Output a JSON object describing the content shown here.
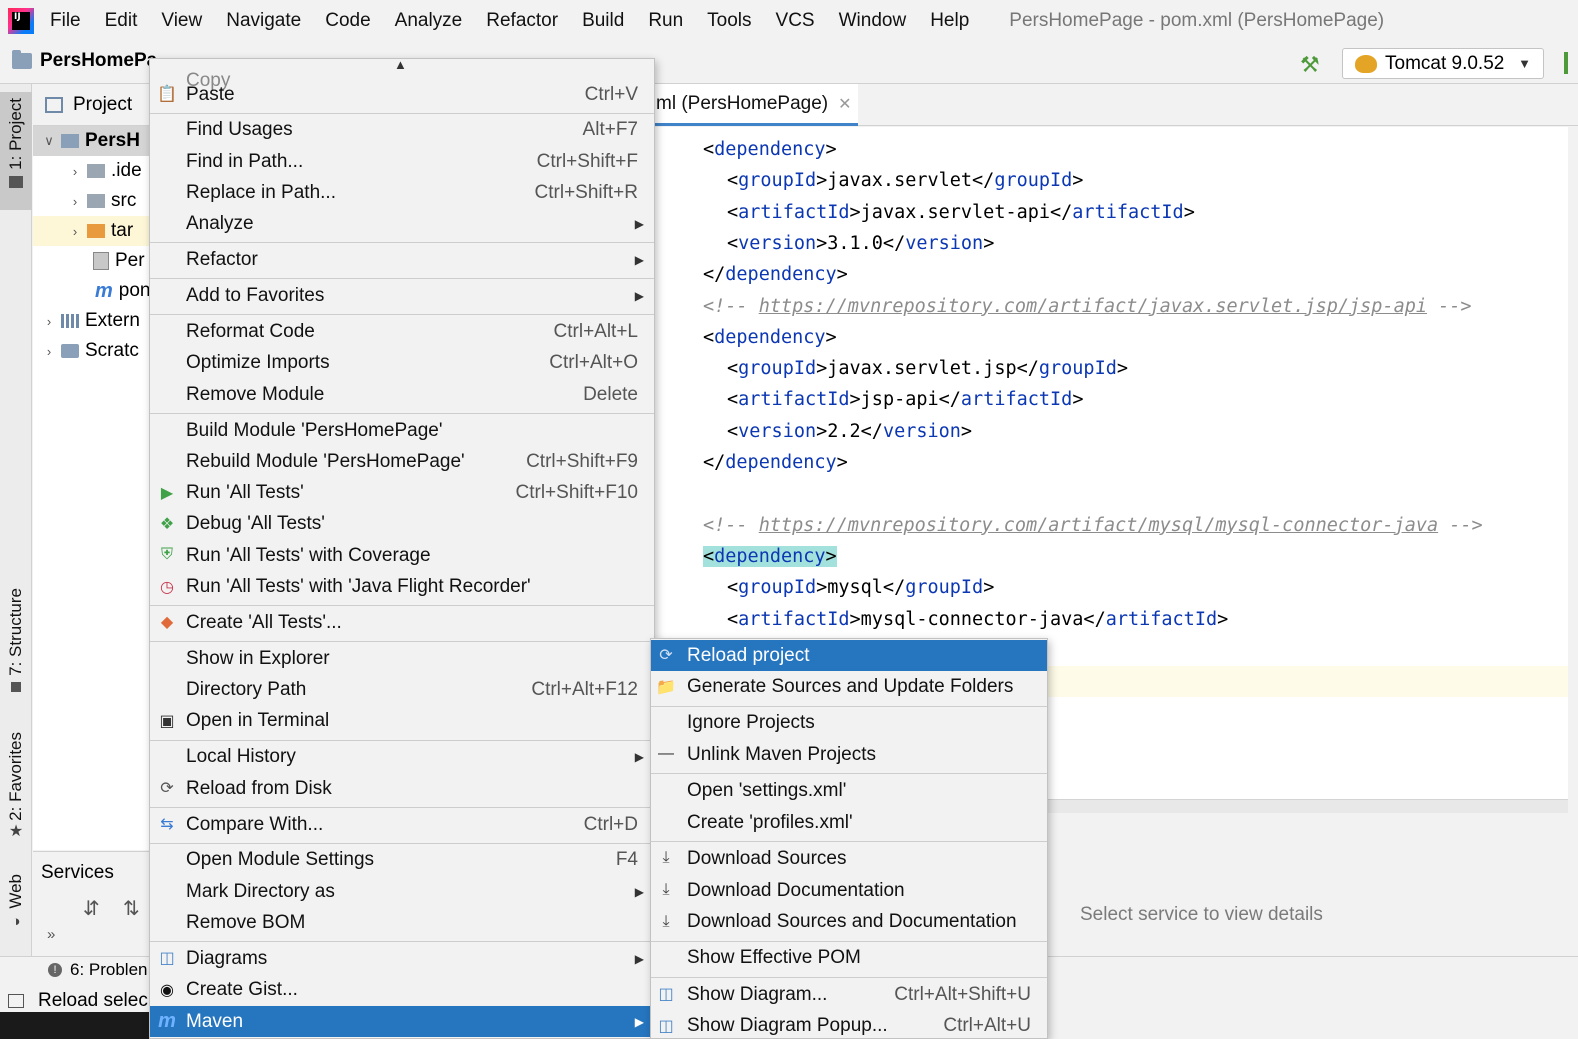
{
  "menubar": {
    "logo_text": "IJ",
    "items": [
      "File",
      "Edit",
      "View",
      "Navigate",
      "Code",
      "Analyze",
      "Refactor",
      "Build",
      "Run",
      "Tools",
      "VCS",
      "Window",
      "Help"
    ],
    "window_title": "PersHomePage - pom.xml (PersHomePage)"
  },
  "toolbar": {
    "project_name": "PersHomePa",
    "run_config": "Tomcat 9.0.52"
  },
  "left_tabs": {
    "project": "1: Project",
    "structure": "7: Structure",
    "favorites": "2: Favorites",
    "web": "Web"
  },
  "project_panel": {
    "title": "Project",
    "rows": [
      {
        "label": "PersH",
        "bold": true
      },
      {
        "label": ".ide"
      },
      {
        "label": "src"
      },
      {
        "label": "tar"
      },
      {
        "label": "Per"
      },
      {
        "label": "pon"
      },
      {
        "label": "Extern"
      },
      {
        "label": "Scratc"
      }
    ]
  },
  "services": {
    "title": "Services",
    "empty_message": "Select service to view details",
    "more": "»"
  },
  "status": {
    "problems": "6: Problen",
    "message": "Reload selec"
  },
  "editor": {
    "tab_title": "ml (PersHomePage)",
    "lines": [
      {
        "indent": 0,
        "tag": "dependency",
        "close": false
      },
      {
        "indent": 1,
        "tag": "groupId",
        "value": "javax.servlet"
      },
      {
        "indent": 1,
        "tag": "artifactId",
        "value": "javax.servlet-api"
      },
      {
        "indent": 1,
        "tag": "version",
        "value": "3.1.0"
      },
      {
        "indent": 0,
        "tag": "dependency",
        "close": true
      },
      {
        "comment": "https://mvnrepository.com/artifact/javax.servlet.jsp/jsp-api"
      },
      {
        "indent": 0,
        "tag": "dependency",
        "close": false
      },
      {
        "indent": 1,
        "tag": "groupId",
        "value": "javax.servlet.jsp"
      },
      {
        "indent": 1,
        "tag": "artifactId",
        "value": "jsp-api"
      },
      {
        "indent": 1,
        "tag": "version",
        "value": "2.2"
      },
      {
        "indent": 0,
        "tag": "dependency",
        "close": true
      },
      {
        "blank": true
      },
      {
        "comment": "https://mvnrepository.com/artifact/mysql/mysql-connector-java"
      },
      {
        "indent": 0,
        "tag": "dependency",
        "close": false,
        "highlight": true
      },
      {
        "indent": 1,
        "tag": "groupId",
        "value": "mysql"
      },
      {
        "indent": 1,
        "tag": "artifactId",
        "value": "mysql-connector-java"
      }
    ]
  },
  "context_menu": {
    "items": [
      {
        "label": "Copy",
        "partial": true
      },
      {
        "label": "Paste",
        "shortcut": "Ctrl+V",
        "icon": "clipboard-icon"
      },
      {
        "sep": true
      },
      {
        "label": "Find Usages",
        "shortcut": "Alt+F7"
      },
      {
        "label": "Find in Path...",
        "shortcut": "Ctrl+Shift+F"
      },
      {
        "label": "Replace in Path...",
        "shortcut": "Ctrl+Shift+R"
      },
      {
        "label": "Analyze",
        "submenu": true
      },
      {
        "sep": true
      },
      {
        "label": "Refactor",
        "submenu": true
      },
      {
        "sep": true
      },
      {
        "label": "Add to Favorites",
        "submenu": true
      },
      {
        "sep": true
      },
      {
        "label": "Reformat Code",
        "shortcut": "Ctrl+Alt+L"
      },
      {
        "label": "Optimize Imports",
        "shortcut": "Ctrl+Alt+O"
      },
      {
        "label": "Remove Module",
        "shortcut": "Delete"
      },
      {
        "sep": true
      },
      {
        "label": "Build Module 'PersHomePage'"
      },
      {
        "label": "Rebuild Module 'PersHomePage'",
        "shortcut": "Ctrl+Shift+F9"
      },
      {
        "label": "Run 'All Tests'",
        "shortcut": "Ctrl+Shift+F10",
        "icon": "run-icon"
      },
      {
        "label": "Debug 'All Tests'",
        "icon": "debug-icon"
      },
      {
        "label": "Run 'All Tests' with Coverage",
        "icon": "coverage-icon"
      },
      {
        "label": "Run 'All Tests' with 'Java Flight Recorder'",
        "icon": "profiler-icon"
      },
      {
        "sep": true
      },
      {
        "label": "Create 'All Tests'...",
        "icon": "create-test-icon"
      },
      {
        "sep": true
      },
      {
        "label": "Show in Explorer"
      },
      {
        "label": "Directory Path",
        "shortcut": "Ctrl+Alt+F12"
      },
      {
        "label": "Open in Terminal",
        "icon": "terminal-icon"
      },
      {
        "sep": true
      },
      {
        "label": "Local History",
        "submenu": true
      },
      {
        "label": "Reload from Disk",
        "icon": "reload-icon"
      },
      {
        "sep": true
      },
      {
        "label": "Compare With...",
        "shortcut": "Ctrl+D",
        "icon": "compare-icon"
      },
      {
        "sep": true
      },
      {
        "label": "Open Module Settings",
        "shortcut": "F4"
      },
      {
        "label": "Mark Directory as",
        "submenu": true
      },
      {
        "label": "Remove BOM"
      },
      {
        "sep": true
      },
      {
        "label": "Diagrams",
        "submenu": true,
        "icon": "diagram-icon"
      },
      {
        "label": "Create Gist...",
        "icon": "github-icon"
      },
      {
        "label": "Maven",
        "submenu": true,
        "icon": "maven-icon",
        "selected": true
      }
    ]
  },
  "maven_submenu": {
    "items": [
      {
        "label": "Reload project",
        "icon": "reload-icon",
        "selected": true
      },
      {
        "label": "Generate Sources and Update Folders",
        "icon": "folder-refresh-icon"
      },
      {
        "sep": true
      },
      {
        "label": "Ignore Projects"
      },
      {
        "label": "Unlink Maven Projects",
        "icon": "minus-icon"
      },
      {
        "sep": true
      },
      {
        "label": "Open 'settings.xml'"
      },
      {
        "label": "Create 'profiles.xml'"
      },
      {
        "sep": true
      },
      {
        "label": "Download Sources",
        "icon": "download-icon"
      },
      {
        "label": "Download Documentation",
        "icon": "download-icon"
      },
      {
        "label": "Download Sources and Documentation",
        "icon": "download-icon"
      },
      {
        "sep": true
      },
      {
        "label": "Show Effective POM"
      },
      {
        "sep": true
      },
      {
        "label": "Show Diagram...",
        "shortcut": "Ctrl+Alt+Shift+U",
        "icon": "diagram-icon"
      },
      {
        "label": "Show Diagram Popup...",
        "shortcut": "Ctrl+Alt+U",
        "icon": "diagram-icon"
      }
    ]
  },
  "colors": {
    "selection": "#2675bf",
    "xml_tag": "#0b37b3",
    "comment": "#8c8c8c"
  }
}
